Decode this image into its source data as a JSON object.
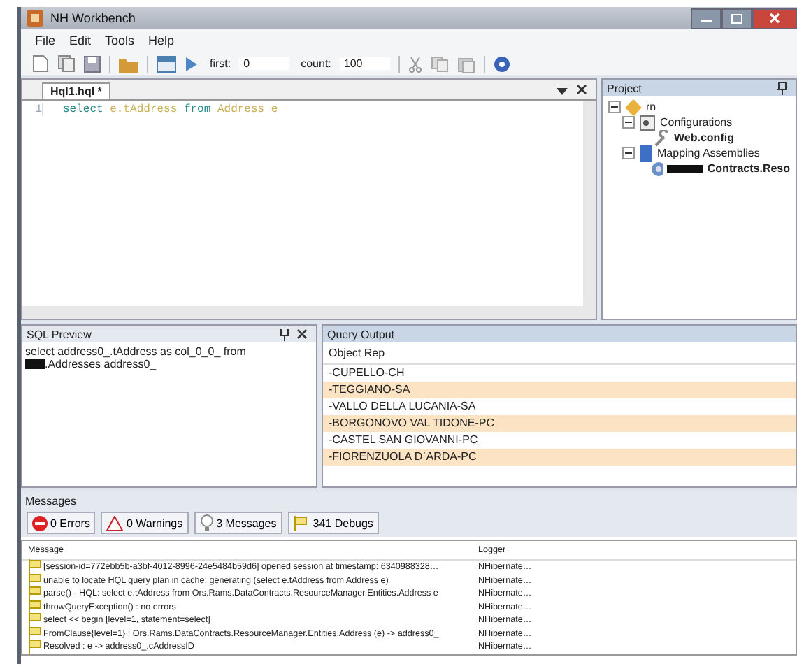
{
  "window": {
    "title": "NH Workbench"
  },
  "menu": [
    "File",
    "Edit",
    "Tools",
    "Help"
  ],
  "toolbar": {
    "first_label": "first:",
    "first_value": "0",
    "count_label": "count:",
    "count_value": "100"
  },
  "editor": {
    "tabs": [
      {
        "label": "Hql1.hql *",
        "selected": true
      }
    ],
    "lines": [
      {
        "number": "1",
        "tokens": [
          {
            "kind": "keyword",
            "text": "select"
          },
          {
            "kind": "ident",
            "text": "e.tAddress"
          },
          {
            "kind": "keyword",
            "text": "from"
          },
          {
            "kind": "ident",
            "text": "Address"
          },
          {
            "kind": "ident",
            "text": "e"
          }
        ]
      }
    ]
  },
  "project": {
    "title": "Project",
    "tree": [
      {
        "label": "rn",
        "kind": "root",
        "bold": false,
        "expanded": true,
        "children": [
          {
            "label": "Configurations",
            "kind": "folder",
            "bold": false,
            "expanded": true,
            "children": [
              {
                "label": "Web.config",
                "kind": "config",
                "bold": true
              }
            ]
          },
          {
            "label": "Mapping Assemblies",
            "kind": "assembly",
            "bold": false,
            "expanded": true,
            "children": [
              {
                "label": "Contracts.Reso",
                "kind": "module",
                "bold": true,
                "redacted": true
              }
            ]
          }
        ]
      }
    ]
  },
  "sql_preview": {
    "title": "SQL Preview",
    "lines": [
      {
        "text": "select address0_.tAddress as col_0_0_ from",
        "redacted": false
      },
      {
        "text": ".Addresses address0_",
        "redacted": true
      }
    ]
  },
  "query_output": {
    "title": "Query Output",
    "column": "Object Rep",
    "rows": [
      "-CUPELLO-CH",
      "-TEGGIANO-SA",
      "-VALLO DELLA LUCANIA-SA",
      "-BORGONOVO VAL TIDONE-PC",
      "-CASTEL SAN GIOVANNI-PC",
      "-FIORENZUOLA D`ARDA-PC"
    ]
  },
  "messages": {
    "title": "Messages",
    "filters": [
      {
        "kind": "error",
        "label": "0 Errors"
      },
      {
        "kind": "warning",
        "label": "0 Warnings"
      },
      {
        "kind": "info",
        "label": "3 Messages"
      },
      {
        "kind": "debug",
        "label": "341 Debugs"
      }
    ],
    "columns": [
      "Message",
      "Logger"
    ],
    "rows": [
      {
        "message": "[session-id=772ebb5b-a3bf-4012-8996-24e5484b59d6] opened session at timestamp: 6340988328…",
        "logger": "NHibernate…"
      },
      {
        "message": "unable to locate HQL query plan in cache; generating (select e.tAddress from Address e)",
        "logger": "NHibernate…"
      },
      {
        "message": "parse() - HQL: select e.tAddress from Ors.Rams.DataContracts.ResourceManager.Entities.Address e",
        "logger": "NHibernate…"
      },
      {
        "message": "throwQueryException() : no errors",
        "logger": "NHibernate…"
      },
      {
        "message": "select << begin [level=1, statement=select]",
        "logger": "NHibernate…"
      },
      {
        "message": "FromClause{level=1} : Ors.Rams.DataContracts.ResourceManager.Entities.Address (e) -> address0_",
        "logger": "NHibernate…"
      },
      {
        "message": "Resolved : e -> address0_.cAddressID",
        "logger": "NHibernate…"
      }
    ]
  }
}
